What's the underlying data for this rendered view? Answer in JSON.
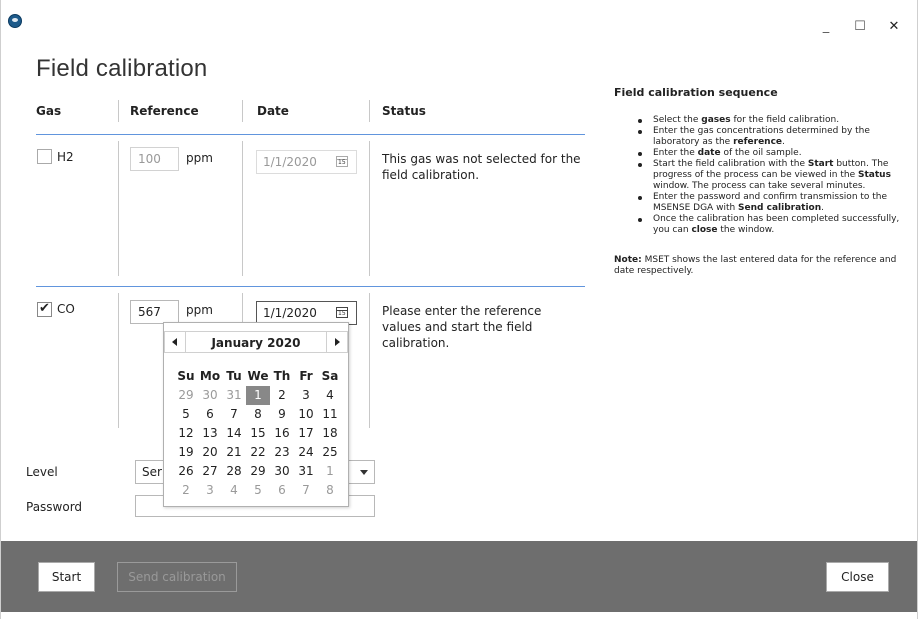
{
  "window": {
    "min_glyph": "_",
    "max_glyph": "☐",
    "close_glyph": "✕",
    "app_icon": "msense-logo-icon"
  },
  "page_title": "Field calibration",
  "table": {
    "headers": {
      "gas": "Gas",
      "reference": "Reference",
      "date": "Date",
      "status": "Status"
    },
    "rows": [
      {
        "gas": "H2",
        "checked": false,
        "reference_value": "100",
        "unit": "ppm",
        "date": "1/1/2020",
        "status": "This gas was not selected for the field calibration."
      },
      {
        "gas": "CO",
        "checked": true,
        "reference_value": "567",
        "unit": "ppm",
        "date": "1/1/2020",
        "status": "Please enter the reference values and start the field calibration."
      }
    ]
  },
  "calendar": {
    "month_label": "January 2020",
    "days_of_week": [
      "Su",
      "Mo",
      "Tu",
      "We",
      "Th",
      "Fr",
      "Sa"
    ],
    "weeks": [
      [
        "29",
        "30",
        "31",
        "1",
        "2",
        "3",
        "4"
      ],
      [
        "5",
        "6",
        "7",
        "8",
        "9",
        "10",
        "11"
      ],
      [
        "12",
        "13",
        "14",
        "15",
        "16",
        "17",
        "18"
      ],
      [
        "19",
        "20",
        "21",
        "22",
        "23",
        "24",
        "25"
      ],
      [
        "26",
        "27",
        "28",
        "29",
        "30",
        "31",
        "1"
      ],
      [
        "2",
        "3",
        "4",
        "5",
        "6",
        "7",
        "8"
      ]
    ],
    "selected_day": "1"
  },
  "level": {
    "label": "Level",
    "value": "Ser"
  },
  "password": {
    "label": "Password",
    "value": ""
  },
  "right_panel": {
    "title": "Field calibration sequence",
    "steps": [
      [
        "Select the ",
        "gases",
        " for the field calibration."
      ],
      [
        "Enter the gas concentrations determined by the laboratory as the ",
        "reference",
        "."
      ],
      [
        "Enter the ",
        "date",
        " of the oil sample."
      ],
      [
        "Start the field calibration with the ",
        "Start",
        " button. The progress of the process can be viewed in the ",
        "Status",
        " window. The process can take several minutes."
      ],
      [
        "Enter the password and confirm transmission to the MSENSE DGA with ",
        "Send calibration",
        "."
      ],
      [
        "Once the calibration has been completed successfully, you can ",
        "close",
        " the window."
      ]
    ],
    "note_label": "Note:",
    "note_text": " MSET shows the last entered data for the reference and date respectively."
  },
  "footer": {
    "start_label": "Start",
    "send_label": "Send calibration",
    "close_label": "Close"
  },
  "colors": {
    "footer_bg": "#6e6e6e",
    "row_divider": "#3a7bd5",
    "selected_day_bg": "#888888"
  }
}
